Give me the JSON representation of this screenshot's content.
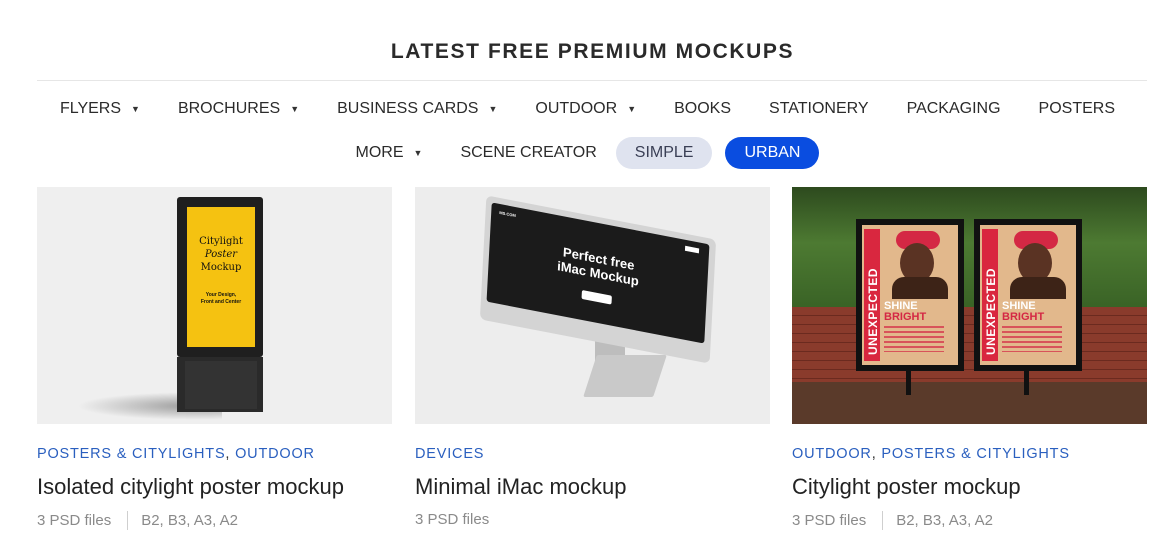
{
  "heading": "LATEST FREE PREMIUM MOCKUPS",
  "nav": {
    "row1": [
      {
        "label": "FLYERS",
        "dropdown": true
      },
      {
        "label": "BROCHURES",
        "dropdown": true
      },
      {
        "label": "BUSINESS CARDS",
        "dropdown": true
      },
      {
        "label": "OUTDOOR",
        "dropdown": true
      },
      {
        "label": "BOOKS",
        "dropdown": false
      },
      {
        "label": "STATIONERY",
        "dropdown": false
      },
      {
        "label": "PACKAGING",
        "dropdown": false
      },
      {
        "label": "POSTERS",
        "dropdown": false
      }
    ],
    "row2": {
      "more": "MORE",
      "scene_creator": "SCENE CREATOR",
      "simple": "SIMPLE",
      "urban": "URBAN"
    },
    "caret_glyph": "▼",
    "active_pill": "URBAN"
  },
  "colors": {
    "accent": "#0a4de0",
    "pill_inactive": "#dfe3ef",
    "category_link": "#2a5fbf"
  },
  "cards": [
    {
      "categories": [
        "POSTERS & CITYLIGHTS",
        "OUTDOOR"
      ],
      "title": "Isolated citylight poster mockup",
      "files": "3 PSD files",
      "sizes": "B2, B3, A3, A2",
      "thumb": {
        "poster_title_1": "Citylight",
        "poster_title_2": "Poster",
        "poster_title_3": "Mockup",
        "poster_sub_1": "Your Design,",
        "poster_sub_2": "Front and Center"
      }
    },
    {
      "categories": [
        "DEVICES"
      ],
      "title": "Minimal iMac mockup",
      "files": "3 PSD files",
      "sizes": "",
      "thumb": {
        "screen_line_1": "Perfect free",
        "screen_line_2": "iMac Mockup",
        "screen_brand": "MS.COM"
      }
    },
    {
      "categories": [
        "OUTDOOR",
        "POSTERS & CITYLIGHTS"
      ],
      "title": "Citylight poster mockup",
      "files": "3 PSD files",
      "sizes": "B2, B3, A3, A2",
      "thumb": {
        "vertical_word": "UNEXPECTED",
        "line_1": "SHINE",
        "line_2": "BRIGHT"
      }
    }
  ]
}
